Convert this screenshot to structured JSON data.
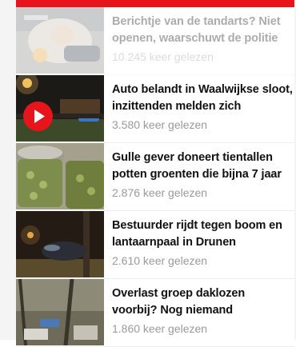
{
  "articles": [
    {
      "headline": "Berichtje van de tandarts? Niet openen, waarschuwt de politie",
      "reads": "10.245 keer gelezen",
      "thumbnail": "dentist-photo"
    },
    {
      "headline": "Auto belandt in Waalwijkse sloot, inzittenden melden zich",
      "reads": "3.580 keer gelezen",
      "thumbnail": "night-ditch-photo",
      "has_video": true
    },
    {
      "headline": "Gulle gever doneert tientallen potten groenten die bijna 7 jaar",
      "reads": "2.876 keer gelezen",
      "thumbnail": "jars-photo"
    },
    {
      "headline": "Bestuurder rijdt tegen boom en lantaarnpaal in Drunen",
      "reads": "2.610 keer gelezen",
      "thumbnail": "crash-tree-photo"
    },
    {
      "headline": "Overlast groep daklozen voorbij? Nog niemand",
      "reads": "1.860 keer gelezen",
      "thumbnail": "camp-photo"
    }
  ],
  "colors": {
    "accent": "#e8141b",
    "headline": "#111111",
    "meta": "#9a9a9a"
  },
  "icons": {
    "play": "play-icon"
  }
}
